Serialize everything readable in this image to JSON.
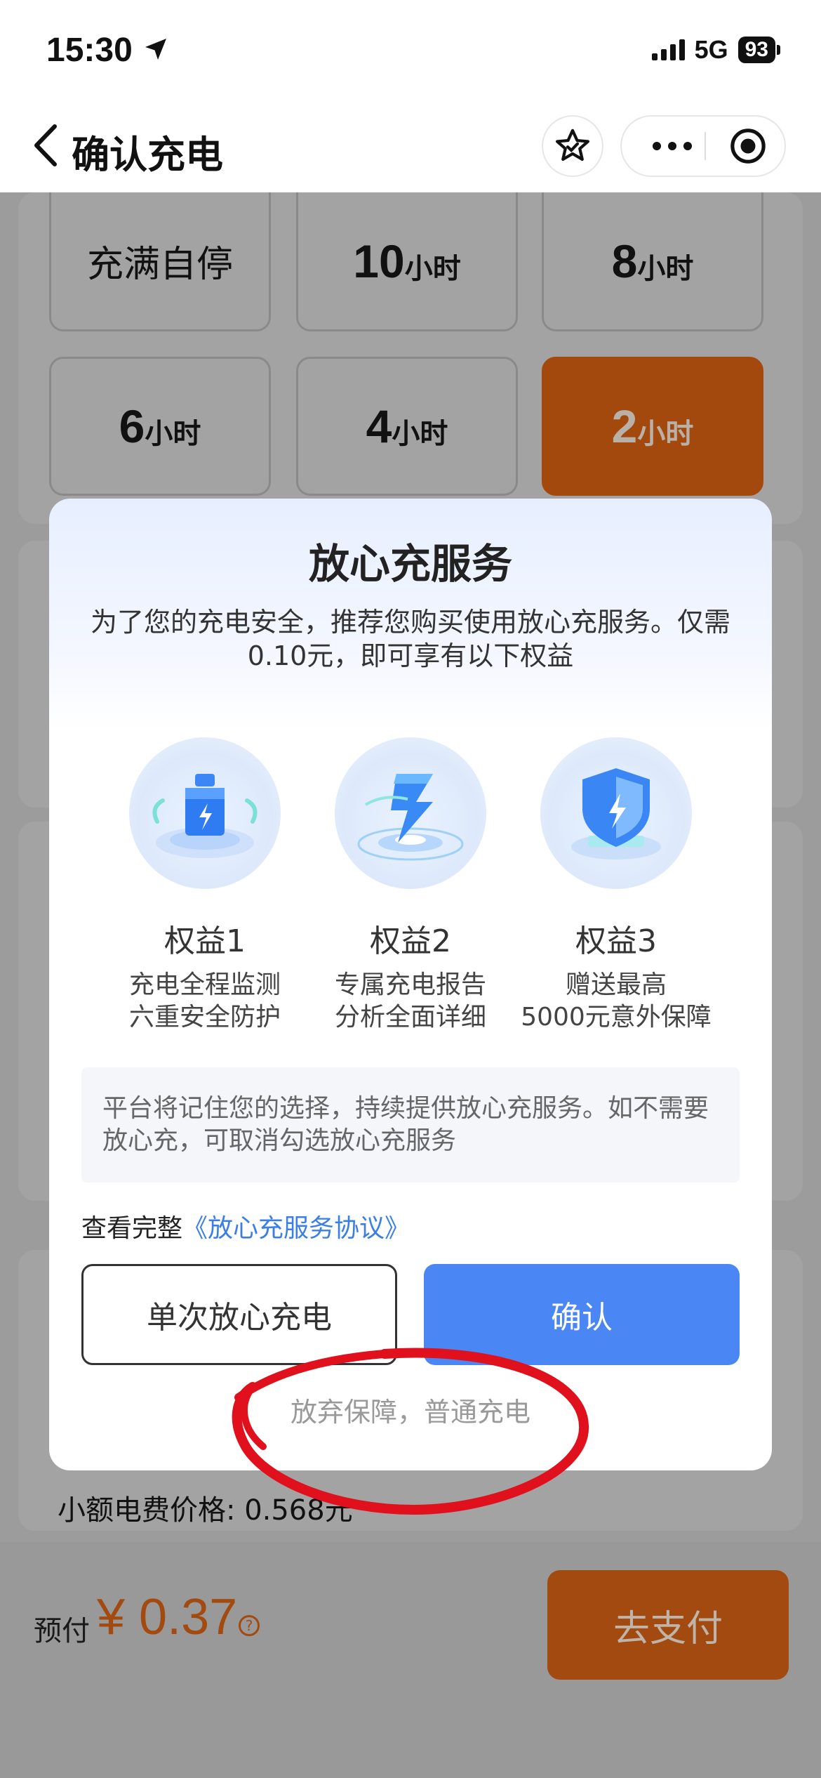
{
  "status_bar": {
    "time": "15:30",
    "network": "5G",
    "battery": "93"
  },
  "nav": {
    "title": "确认充电"
  },
  "duration_options": {
    "row1": [
      {
        "full": "充满自停"
      },
      {
        "num": "10",
        "unit": "小时"
      },
      {
        "num": "8",
        "unit": "小时"
      }
    ],
    "row2": [
      {
        "num": "6",
        "unit": "小时"
      },
      {
        "num": "4",
        "unit": "小时"
      },
      {
        "num": "2",
        "unit": "小时",
        "selected": true
      }
    ]
  },
  "background": {
    "price_line": "小额电费价格: 0.568元",
    "prepay_label": "预付",
    "prepay_amount": "¥ 0.37",
    "pay_button": "去支付"
  },
  "modal": {
    "title": "放心充服务",
    "description": "为了您的充电安全，推荐您购买使用放心充服务。仅需0.10元，即可享有以下权益",
    "benefits": [
      {
        "icon": "monitor-cube-icon",
        "name": "权益1",
        "line1": "充电全程监测",
        "line2": "六重安全防护"
      },
      {
        "icon": "lightning-report-icon",
        "name": "权益2",
        "line1": "专属充电报告",
        "line2": "分析全面详细"
      },
      {
        "icon": "shield-icon",
        "name": "权益3",
        "line1": "赠送最高",
        "line2": "5000元意外保障"
      }
    ],
    "notice": "平台将记住您的选择，持续提供放心充服务。如不需要放心充，可取消勾选放心充服务",
    "agreement_prefix": "查看完整",
    "agreement_link": "《放心充服务协议》",
    "single_button": "单次放心充电",
    "confirm_button": "确认",
    "abandon_link": "放弃保障，普通充电"
  },
  "colors": {
    "accent_blue": "#4a87f5",
    "link_blue": "#3b7fe6",
    "orange_dimmed": "#a4490e",
    "annotation_red": "#e0101c"
  }
}
